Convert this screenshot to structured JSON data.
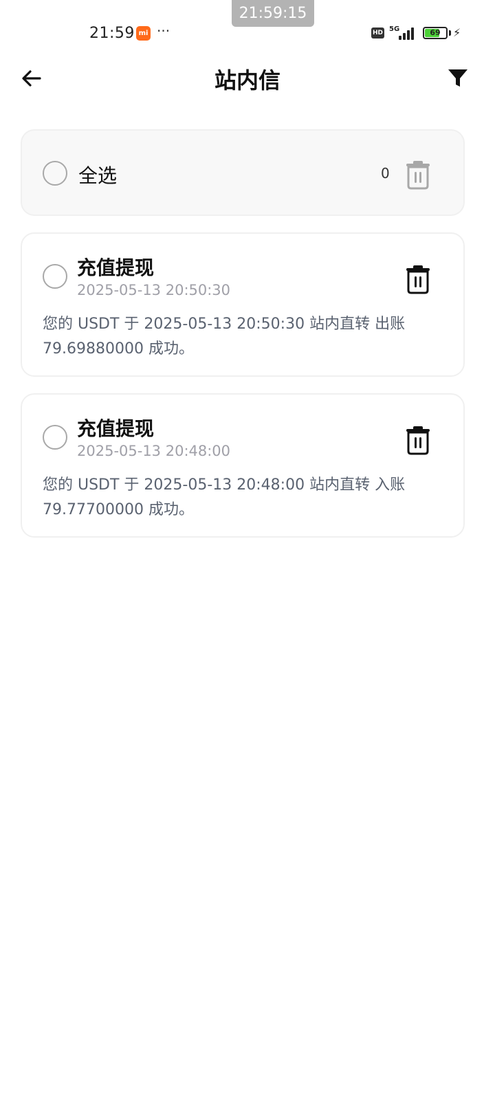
{
  "overlay": {
    "time": "21:59:15"
  },
  "status_bar": {
    "time": "21:59",
    "mi_icon_label": "mi",
    "more": "···",
    "hd": "HD",
    "network": "5G",
    "battery": "69"
  },
  "header": {
    "title": "站内信"
  },
  "select_all": {
    "label": "全选",
    "count": "0"
  },
  "messages": [
    {
      "title": "充值提现",
      "time": "2025-05-13 20:50:30",
      "body": "您的 USDT 于 2025-05-13 20:50:30 站内直转 出账 79.69880000 成功。"
    },
    {
      "title": "充值提现",
      "time": "2025-05-13 20:48:00",
      "body": "您的 USDT 于 2025-05-13 20:48:00 站内直转 入账 79.77700000 成功。"
    }
  ],
  "colors": {
    "accent_battery": "#4cd137",
    "mi_brand": "#ff6a1a",
    "muted_text": "#a0a0a8",
    "body_text": "#5a6270"
  }
}
